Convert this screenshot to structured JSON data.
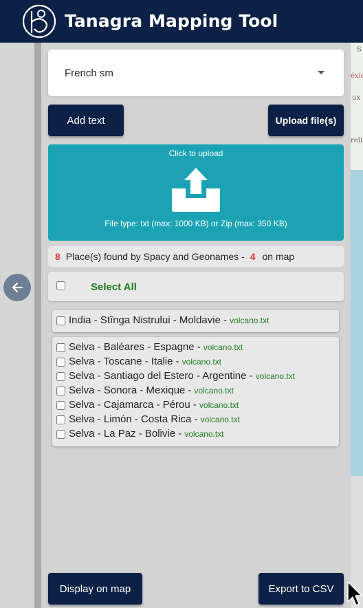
{
  "app": {
    "title": "Tanagra Mapping Tool"
  },
  "icons": {
    "logo": "tanagra-logo-icon",
    "back": "arrow-left-icon",
    "upload": "upload-icon",
    "caret": "caret-down-icon",
    "cursor": "mouse-cursor-icon"
  },
  "colors": {
    "header": "#0b2146",
    "upload_zone": "#1ba3b4",
    "accent_green": "#1b7d1e",
    "count_red": "#d9393c"
  },
  "language_select": {
    "value": "French sm"
  },
  "buttons": {
    "add_text": "Add text",
    "upload_files": "Upload file(s)",
    "display_on_map": "Display on map",
    "export_csv": "Export to CSV"
  },
  "upload": {
    "hint": "Click to upload",
    "types": "File type: txt (max: 1000 KB) or Zip (max: 350 KB)"
  },
  "found": {
    "count": "8",
    "text": "Place(s) found by Spacy and Geonames -",
    "on_map_count": "4",
    "on_map_text": "on map"
  },
  "select_all": {
    "label": "Select All",
    "checked": false
  },
  "groups": [
    {
      "items": [
        {
          "place": "India - Stînga Nistrului - Moldavie -",
          "file": "volcano.txt",
          "checked": false
        }
      ]
    },
    {
      "items": [
        {
          "place": "Selva - Baléares - Espagne -",
          "file": "volcano.txt",
          "checked": false
        },
        {
          "place": "Selva - Toscane - Italie -",
          "file": "volcano.txt",
          "checked": false
        },
        {
          "place": "Selva - Santiago del Estero - Argentine -",
          "file": "volcano.txt",
          "checked": false
        },
        {
          "place": "Selva - Sonora - Mexique -",
          "file": "volcano.txt",
          "checked": false
        },
        {
          "place": "Selva - Cajamarca - Pérou -",
          "file": "volcano.txt",
          "checked": false
        },
        {
          "place": "Selva - Limón - Costa Rica -",
          "file": "volcano.txt",
          "checked": false
        },
        {
          "place": "Selva - La Paz - Bolivie -",
          "file": "volcano.txt",
          "checked": false
        }
      ]
    }
  ],
  "map_labels": {
    "a": "S",
    "b": "éxic",
    "c": "ux",
    "d": "relia"
  }
}
